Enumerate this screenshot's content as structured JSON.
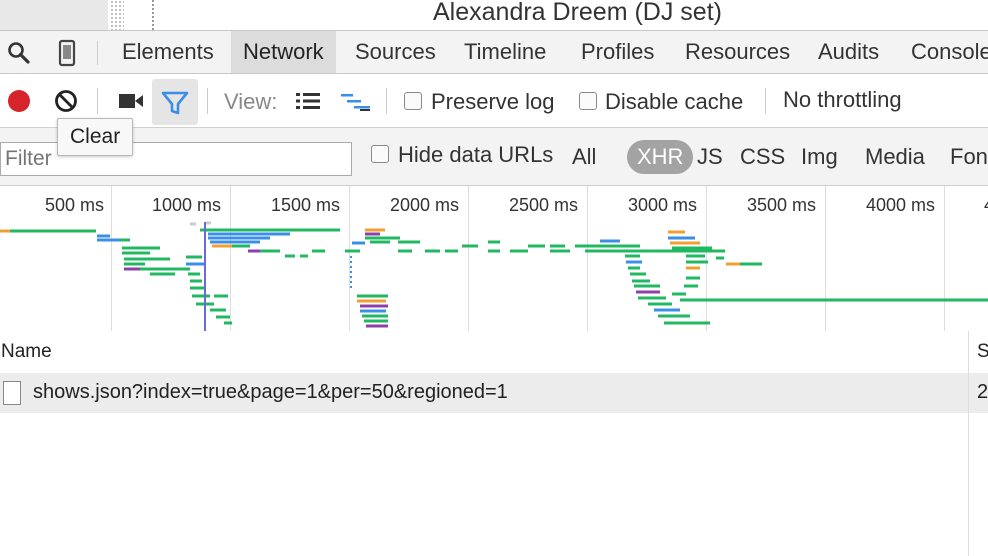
{
  "page": {
    "title": "Alexandra Dreem (DJ set)"
  },
  "icons": {
    "search": "search-icon",
    "device": "device-mode-icon",
    "record": "record-icon",
    "clear": "clear-icon",
    "capture": "video-camera-icon",
    "filter": "filter-icon",
    "large_rows": "large-rows-icon",
    "overview": "overview-icon",
    "file": "file-icon"
  },
  "colors": {
    "record": "#d6242b",
    "filter_active": "#3a8ee8",
    "active_pill": "#a3a3a3"
  },
  "tabs": [
    "Elements",
    "Network",
    "Sources",
    "Timeline",
    "Profiles",
    "Resources",
    "Audits",
    "Console"
  ],
  "active_tab": "Network",
  "controls": {
    "view_label": "View:",
    "preserve_log": "Preserve log",
    "disable_cache": "Disable cache",
    "throttling": "No throttling"
  },
  "tooltip": "Clear",
  "filter": {
    "placeholder": "Filter",
    "hide_data_urls": "Hide data URLs",
    "types": [
      "All",
      "XHR",
      "JS",
      "CSS",
      "Img",
      "Media",
      "Font"
    ],
    "active_type": "XHR"
  },
  "timeline": {
    "ticks": [
      "500 ms",
      "1000 ms",
      "1500 ms",
      "2000 ms",
      "2500 ms",
      "3000 ms",
      "3500 ms",
      "4000 ms",
      "4"
    ]
  },
  "table": {
    "columns": [
      "Name",
      "S"
    ],
    "rows": [
      {
        "name": "shows.json?index=true&page=1&per=50&regioned=1",
        "status": "2"
      }
    ]
  }
}
